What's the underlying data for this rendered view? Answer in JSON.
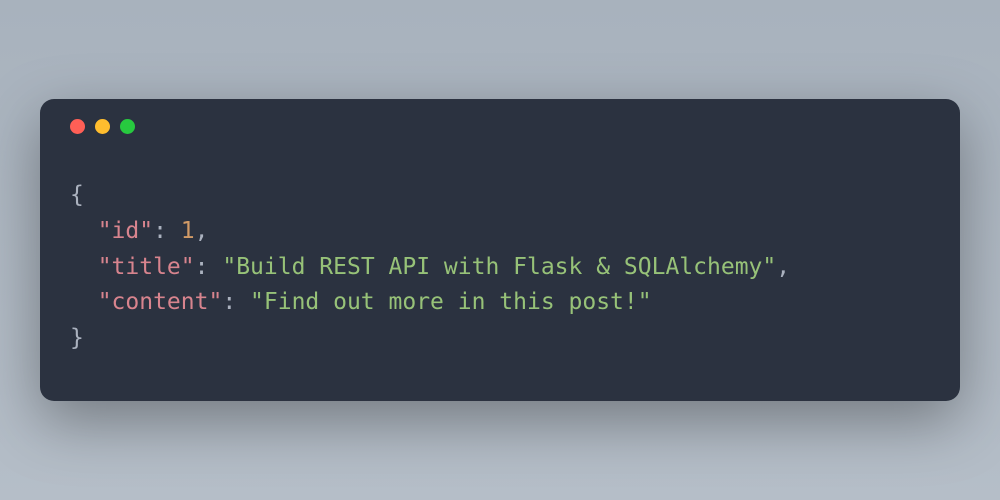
{
  "json_display": {
    "keys": {
      "id": "\"id\"",
      "title": "\"title\"",
      "content": "\"content\""
    },
    "values": {
      "id": "1",
      "title": "\"Build REST API with Flask & SQLAlchemy\"",
      "content": "\"Find out more in this post!\""
    },
    "syntax": {
      "open_brace": "{",
      "close_brace": "}",
      "colon": ":",
      "comma": ","
    }
  },
  "colors": {
    "window_bg": "#2b3240",
    "background": "#a8b2bd",
    "red": "#ff5f56",
    "yellow": "#ffbd2e",
    "green": "#27c93f",
    "key_color": "#d8848e",
    "string_color": "#97c278",
    "number_color": "#d19a66",
    "brace_color": "#abb2bf"
  }
}
